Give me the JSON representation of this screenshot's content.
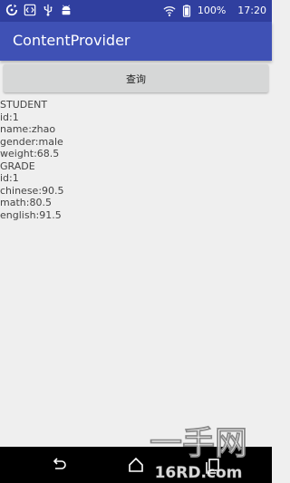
{
  "status_bar": {
    "battery_percent": "100%",
    "time": "17:20",
    "icons": [
      "sync-icon",
      "code-icon",
      "usb-icon",
      "android-icon",
      "wifi-icon",
      "battery-icon"
    ]
  },
  "app_bar": {
    "title": "ContentProvider"
  },
  "query_button": {
    "label": "查询"
  },
  "content": {
    "lines": [
      "STUDENT",
      "id:1",
      "name:zhao",
      "gender:male",
      "weight:68.5",
      "GRADE",
      "id:1",
      "chinese:90.5",
      "math:80.5",
      "english:91.5"
    ]
  },
  "nav_bar": {
    "icons": [
      "back-icon",
      "home-icon",
      "recents-icon"
    ]
  },
  "watermark": {
    "text_top": "一手网",
    "text_bottom": "16RD.com"
  },
  "colors": {
    "status_bar": "#303f9f",
    "app_bar": "#3f51b5",
    "background": "#efefef",
    "button": "#d6d7d7"
  }
}
